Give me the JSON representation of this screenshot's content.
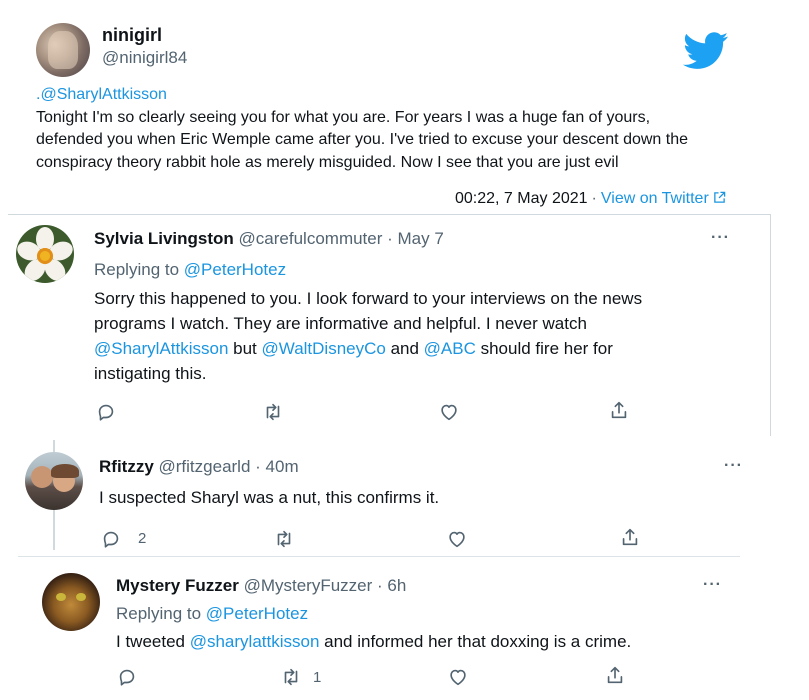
{
  "embed": {
    "display_name": "ninigirl",
    "handle": "@ninigirl84",
    "text_lines": [
      ".@SharylAttkisson",
      "Tonight I'm so clearly seeing you for what you are. For years I was a huge fan of yours,",
      "defended you when Eric Wemple came after you. I've tried to excuse your descent down the",
      "conspiracy theory rabbit hole as merely misguided. Now I see that you are just evil"
    ],
    "timestamp": "00:22, 7 May 2021",
    "separator": "·",
    "view_on_twitter": "View on Twitter",
    "icons": {
      "logo": "twitter-bird-icon",
      "external": "external-link-icon"
    },
    "brand_color": "#1da1f2"
  },
  "replies": [
    {
      "display_name": "Sylvia Livingston",
      "handle": "@carefulcommuter",
      "time": "· May 7",
      "replying_prefix": "Replying to",
      "replying_to": "@PeterHotez",
      "body": {
        "l1": "Sorry this happened to you. I look forward to your interviews on the news",
        "l2": "programs I watch. They are informative and helpful. I never watch",
        "m1": "@SharylAttkisson",
        "t1": " but ",
        "m2": "@WaltDisneyCo",
        "t2": " and ",
        "m3": "@ABC",
        "t3": " should fire her for",
        "l4": "instigating this."
      },
      "more": "···",
      "reply_count": "",
      "retweet_count": "",
      "like_count": ""
    },
    {
      "display_name": "Rfitzzy",
      "handle": "@rfitzgearld",
      "time": "· 40m",
      "body": "I suspected Sharyl was a nut, this confirms it.",
      "more": "···",
      "reply_count": "2",
      "retweet_count": "",
      "like_count": ""
    },
    {
      "display_name": "Mystery Fuzzer",
      "handle": "@MysteryFuzzer",
      "time": "· 6h",
      "replying_prefix": "Replying to",
      "replying_to": "@PeterHotez",
      "body_pre": "I tweeted ",
      "body_mention": "@sharylattkisson",
      "body_post": " and informed her that doxxing is a crime.",
      "more": "···",
      "reply_count": "",
      "retweet_count": "1",
      "like_count": ""
    }
  ],
  "action_icons": [
    "reply-icon",
    "retweet-icon",
    "like-icon",
    "share-icon"
  ],
  "colors": {
    "link": "#1b95e0",
    "secondary": "#536471",
    "text": "#0f1419"
  }
}
